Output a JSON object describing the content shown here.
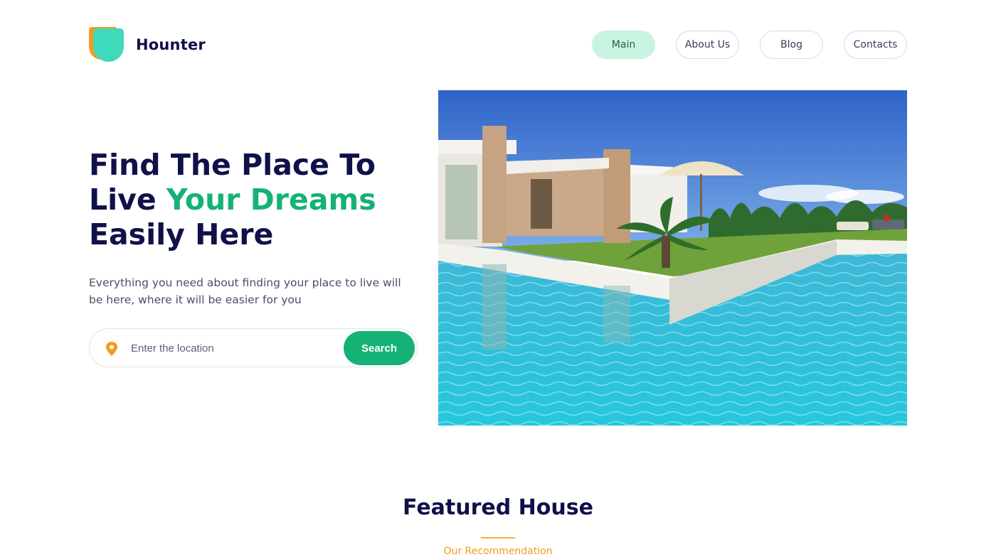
{
  "brand": {
    "name": "Hounter",
    "colors": {
      "orange": "#f29b1d",
      "teal": "#3fd9bc",
      "green": "#14b274",
      "navy": "#10104a"
    }
  },
  "nav": {
    "items": [
      {
        "label": "Main",
        "active": true
      },
      {
        "label": "About Us",
        "active": false
      },
      {
        "label": "Blog",
        "active": false
      },
      {
        "label": "Contacts",
        "active": false
      }
    ]
  },
  "hero": {
    "title_line1": "Find The Place To",
    "title_line2_plain": "Live ",
    "title_line2_accent": "Your Dreams",
    "title_line3": "Easily Here",
    "description": "Everything you need about finding your place to live will be here, where it will be easier for you",
    "image_icon": "villa-pool-photo"
  },
  "search": {
    "placeholder": "Enter the location",
    "value": "",
    "button_label": "Search",
    "icon": "location-pin-icon"
  },
  "featured": {
    "title": "Featured House",
    "subtitle": "Our Recommendation"
  }
}
